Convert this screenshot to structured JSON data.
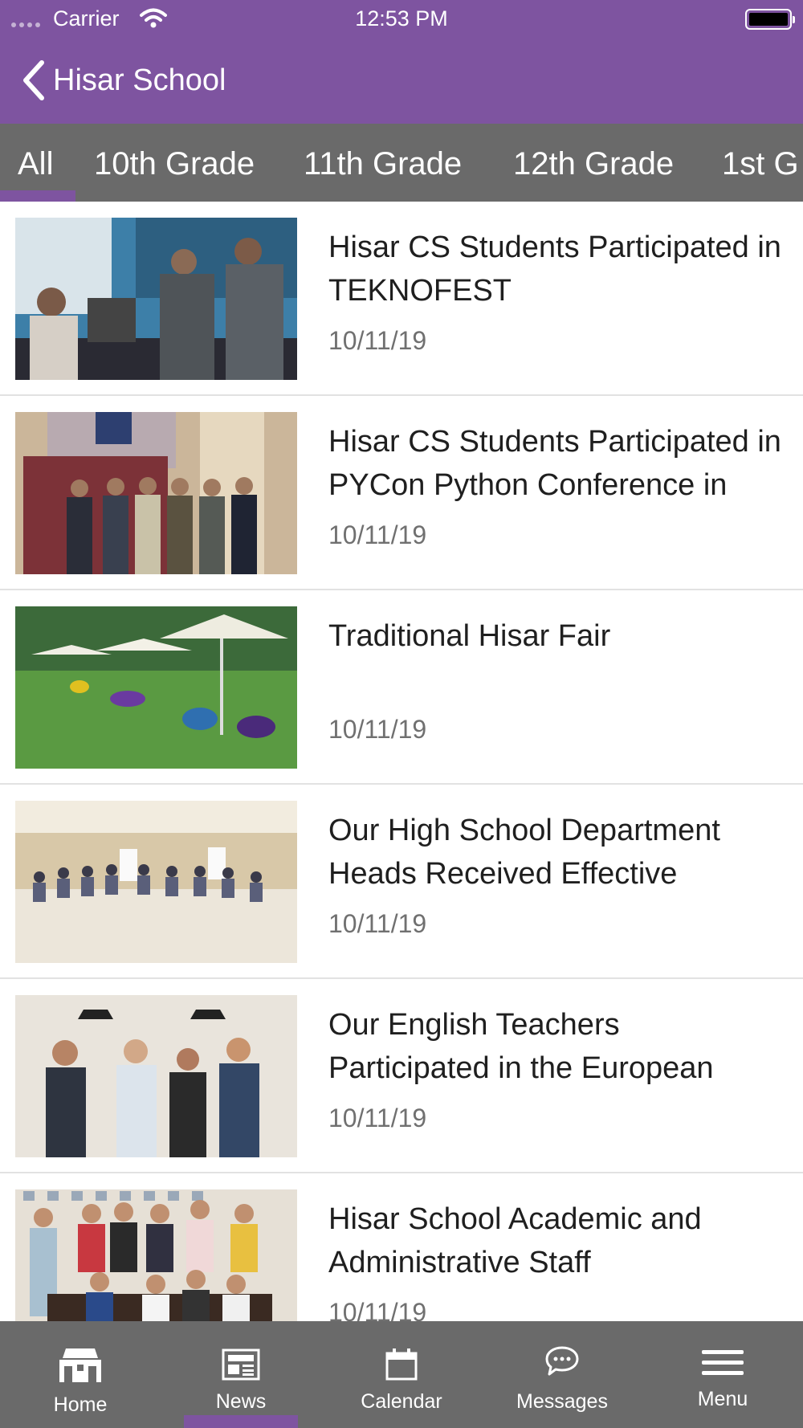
{
  "status_bar": {
    "carrier": "Carrier",
    "time": "12:53 PM",
    "icons": [
      "signal-dots-icon",
      "wifi-icon",
      "battery-icon"
    ]
  },
  "nav": {
    "back_icon": "chevron-left-icon",
    "title": "Hisar School"
  },
  "colors": {
    "brand_purple": "#7e54a0",
    "bar_gray": "#6a6a6a",
    "date_gray": "#707070"
  },
  "tabs": [
    {
      "label": "All",
      "selected": true
    },
    {
      "label": "10th Grade",
      "selected": false
    },
    {
      "label": "11th Grade",
      "selected": false
    },
    {
      "label": "12th Grade",
      "selected": false
    },
    {
      "label": "1st G",
      "selected": false
    }
  ],
  "news": [
    {
      "title": "Hisar CS Students Participated in TEKNOFEST",
      "date": "10/11/19"
    },
    {
      "title": "Hisar CS Students Participated in PYCon Python Conference in",
      "date": "10/11/19"
    },
    {
      "title": "Traditional Hisar Fair",
      "date": "10/11/19"
    },
    {
      "title": "Our High School Department Heads Received Effective",
      "date": "10/11/19"
    },
    {
      "title": "Our English Teachers Participated in the European",
      "date": "10/11/19"
    },
    {
      "title": "Hisar School Academic and Administrative Staff",
      "date": "10/11/19"
    }
  ],
  "bottom_tabs": [
    {
      "label": "Home",
      "icon": "school-building-icon",
      "selected": false
    },
    {
      "label": "News",
      "icon": "newspaper-icon",
      "selected": true
    },
    {
      "label": "Calendar",
      "icon": "calendar-icon",
      "selected": false
    },
    {
      "label": "Messages",
      "icon": "chat-bubble-icon",
      "selected": false
    },
    {
      "label": "Menu",
      "icon": "hamburger-menu-icon",
      "selected": false
    }
  ]
}
